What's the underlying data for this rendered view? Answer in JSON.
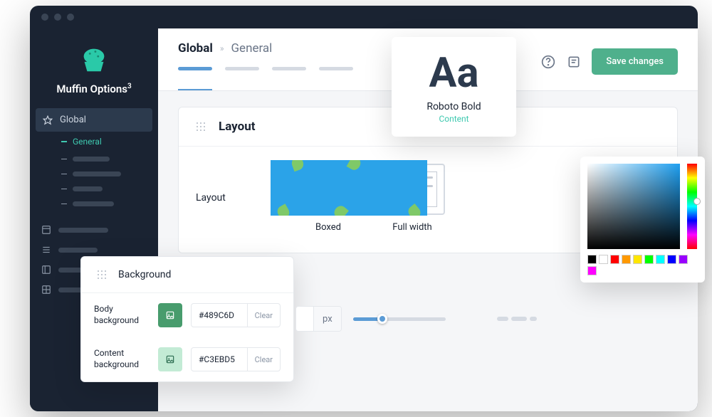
{
  "brand": {
    "name": "Muffin Options",
    "sup": "3"
  },
  "sidebar": {
    "global": "Global",
    "general": "General"
  },
  "breadcrumb": {
    "root": "Global",
    "sep": "»",
    "current": "General"
  },
  "actions": {
    "save": "Save changes"
  },
  "layout_card": {
    "title": "Layout",
    "field_label": "Layout",
    "options": {
      "boxed": "Boxed",
      "full": "Full width"
    }
  },
  "font_card": {
    "sample": "Aa",
    "name": "Roboto Bold",
    "tag": "Content"
  },
  "bg_panel": {
    "title": "Background",
    "rows": [
      {
        "label": "Body background",
        "hex": "#489C6D",
        "clear": "Clear",
        "swatch": "#489C6D"
      },
      {
        "label": "Content background",
        "hex": "#C3EBD5",
        "clear": "Clear",
        "swatch": "#C3EBD5"
      }
    ]
  },
  "controls": {
    "value": "",
    "unit": "px"
  },
  "picker_swatches": [
    "#000000",
    "#ffffff",
    "#ff0000",
    "#ff9900",
    "#ffff00",
    "#00ff00",
    "#00ffff",
    "#0000ff",
    "#9900ff",
    "#ff00ff"
  ]
}
